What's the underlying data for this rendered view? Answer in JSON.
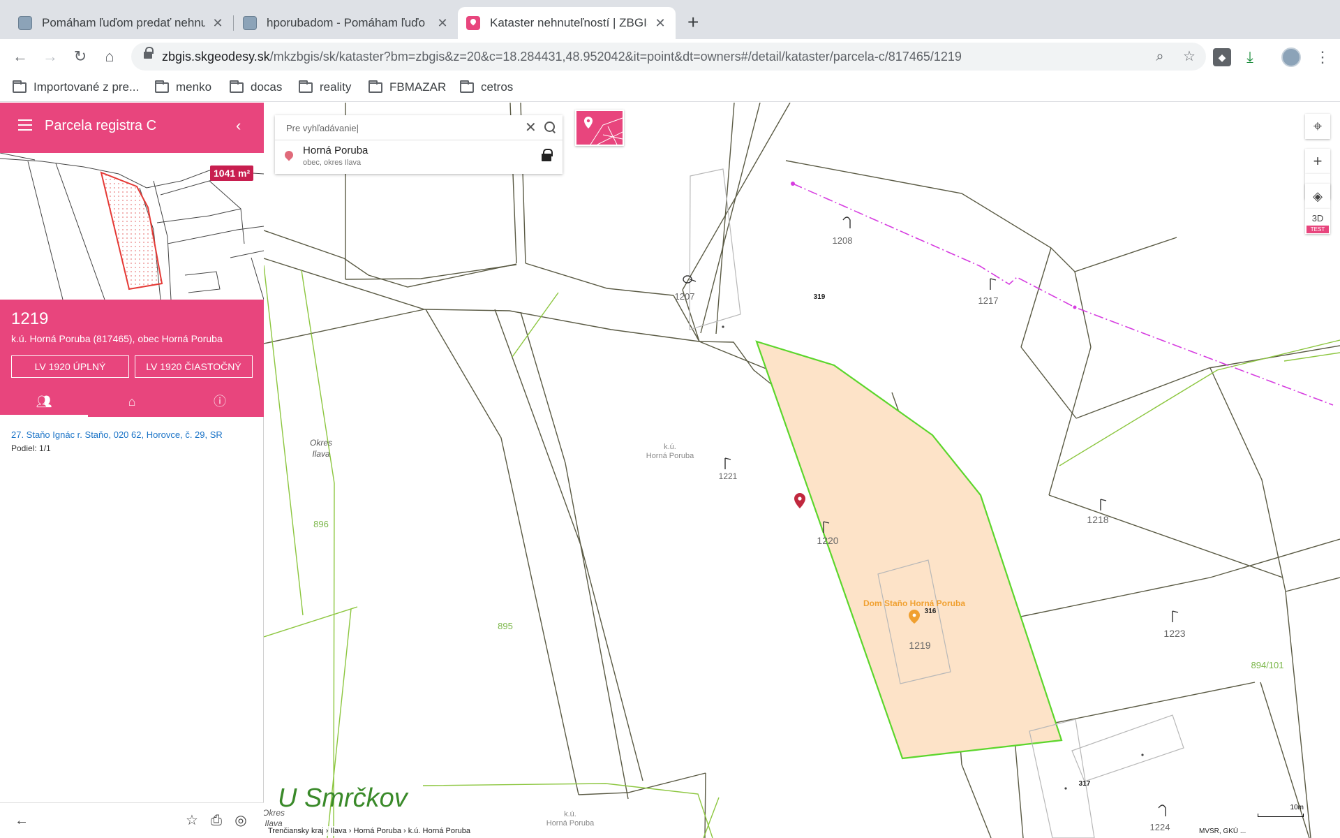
{
  "browser": {
    "tabs": [
      {
        "title": "Pomáham ľuďom predať nehnu",
        "active": false
      },
      {
        "title": "hporubadom - Pomáham ľuďo",
        "active": false
      },
      {
        "title": "Kataster nehnuteľností | ZBGIS",
        "active": true
      }
    ],
    "url_host": "zbgis.skgeodesy.sk",
    "url_rest": "/mkzbgis/sk/kataster?bm=zbgis&z=20&c=18.284431,48.952042&it=point&dt=owners#/detail/kataster/parcela-c/817465/1219",
    "bookmarks": [
      "Importované z pre...",
      "menko",
      "docas",
      "reality",
      "FBMAZAR",
      "cetros"
    ]
  },
  "sidebar": {
    "title": "Parcela registra C",
    "area_badge": "1041 m²",
    "parcel_number": "1219",
    "ku_line": "k.ú. Horná Poruba (817465), obec Horná Poruba",
    "btn_full": "LV 1920 ÚPLNÝ",
    "btn_partial": "LV 1920 ČIASTOČNÝ",
    "owner": "27. Staňo Ignác r. Staňo, 020 62, Horovce, č. 29, SR",
    "share": "Podiel: 1/1"
  },
  "search": {
    "placeholder": "Pre vyhľadávanie|",
    "result_name": "Horná Poruba",
    "result_sub": "obec, okres Ilava"
  },
  "map": {
    "labels": {
      "p1208": "1208",
      "p1207": "1207",
      "p319": "319",
      "p1217": "1217",
      "p1221": "1221",
      "ku1": "k.ú.",
      "ku1b": "Horná Poruba",
      "okres1": "Okres",
      "okres2": "Ilava",
      "p896": "896",
      "p1220": "1220",
      "p1218": "1218",
      "p895": "895",
      "dom": "Dom Staňo Horná Poruba",
      "p316": "316",
      "p1219": "1219",
      "p1223": "1223",
      "p894": "894/101",
      "place": "U Smrčkov",
      "p317": "317",
      "ku2": "k.ú.",
      "ku2b": "Horná Poruba",
      "p1224": "1224",
      "okres3": "Okres",
      "okres4": "Ilava"
    },
    "controls": {
      "three_d": "3D",
      "test": "TEST"
    },
    "breadcrumb": "Trenčiansky kraj  ›  Ilava  ›  Horná Poruba  ›  k.ú. Horná Poruba",
    "scale": "10m",
    "attribution": "MVSR, GKÚ ..."
  },
  "colors": {
    "accent": "#e8457d",
    "selected_fill": "#fde3c8",
    "selected_border": "#5cd62c",
    "kataster_line": "#5a5a44",
    "ekn_line": "#8cc63f",
    "place_label": "#3a8a2a",
    "poi": "#f0a030"
  },
  "icons": [
    "menu-icon",
    "chevron-left-icon",
    "owners-icon",
    "home-icon",
    "info-icon",
    "back-icon",
    "star-icon",
    "print-icon",
    "locate-icon",
    "search-icon",
    "clear-icon",
    "lock-icon",
    "pin-icon",
    "zoom-in-icon",
    "zoom-out-icon",
    "layers-icon",
    "gps-icon"
  ]
}
